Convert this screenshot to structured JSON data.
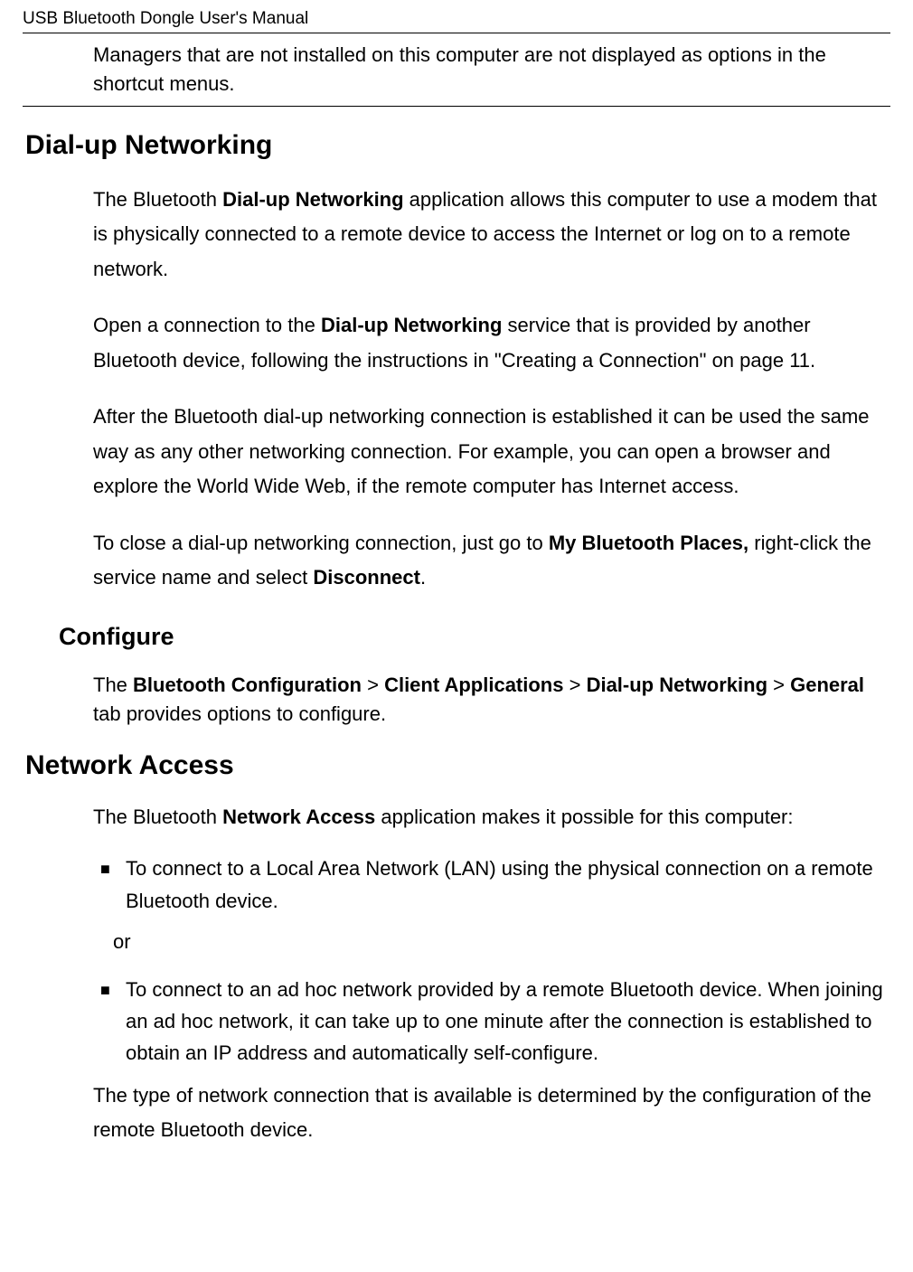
{
  "header": {
    "title": "USB Bluetooth Dongle User's Manual",
    "note": "Managers that are not installed on this computer are not displayed as options in the shortcut menus."
  },
  "sections": {
    "dialup": {
      "heading": "Dial-up Networking",
      "p1_a": "The Bluetooth ",
      "p1_b": "Dial-up Networking",
      "p1_c": " application allows this computer to use a modem that is physically connected to a remote device to access the Internet or log on to a remote network.",
      "p2_a": "Open a connection to the ",
      "p2_b": "Dial-up Networking",
      "p2_c": " service that is provided by another Bluetooth device, following the instructions in \"Creating a Connection\" on page 11.",
      "p3": "After the Bluetooth dial-up networking connection is established it can be used the same way as any other networking connection. For example, you can open a browser and explore the World Wide Web, if the remote computer has Internet access.",
      "p4_a": "To close a dial-up networking connection, just go to ",
      "p4_b": "My Bluetooth Places,",
      "p4_c": " right-click the service name and select ",
      "p4_d": "Disconnect",
      "p4_e": "."
    },
    "configure": {
      "heading": "Configure",
      "p1_a": "The ",
      "p1_b": "Bluetooth Configuration",
      "p1_c": " > ",
      "p1_d": "Client Applications",
      "p1_e": " > ",
      "p1_f": "Dial-up Networking",
      "p1_g": " > ",
      "p1_h": "General",
      "p1_i": " tab provides options to configure."
    },
    "network": {
      "heading": "Network Access",
      "p1_a": "The Bluetooth ",
      "p1_b": "Network Access",
      "p1_c": " application makes it possible for this computer:",
      "item1": "To connect to a Local Area Network (LAN) using the physical connection on a remote Bluetooth device.",
      "or": "or",
      "item2": "To connect to an ad hoc network provided by a remote Bluetooth device. When joining an ad hoc network, it can take up to one minute after the connection is established to obtain an IP address and automatically self-configure.",
      "p2": "The type of network connection that is available is determined by the configuration of the remote Bluetooth device."
    }
  }
}
